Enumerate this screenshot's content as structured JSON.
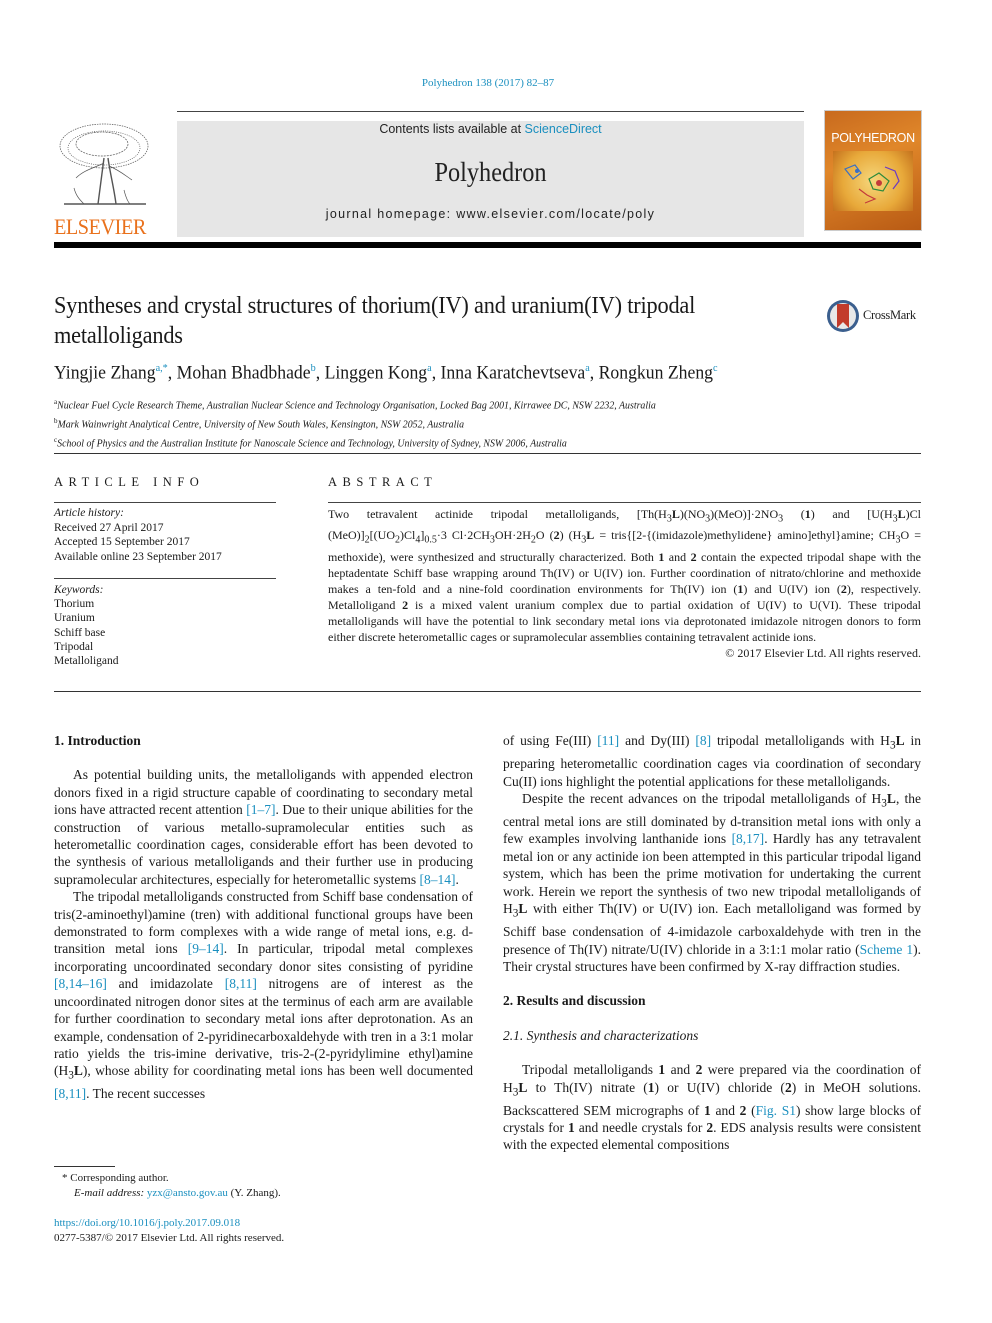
{
  "journal_ref": "Polyhedron 138 (2017) 82–87",
  "masthead": {
    "contents_prefix": "Contents lists available at ",
    "contents_link": "ScienceDirect",
    "journal_name": "Polyhedron",
    "homepage": "journal homepage: www.elsevier.com/locate/poly",
    "publisher_logo": "ELSEVIER",
    "cover_title": "POLYHEDRON"
  },
  "colors": {
    "link": "#1a8fbf",
    "elsevier_orange": "#e9711c",
    "masthead_bg": "#e6e6e6"
  },
  "title": "Syntheses and crystal structures of thorium(IV) and uranium(IV) tripodal metalloligands",
  "crossmark": "CrossMark",
  "authors": [
    {
      "name": "Yingjie Zhang",
      "sup": "a,*"
    },
    {
      "name": "Mohan Bhadbhade",
      "sup": "b"
    },
    {
      "name": "Linggen Kong",
      "sup": "a"
    },
    {
      "name": "Inna Karatchevtseva",
      "sup": "a"
    },
    {
      "name": "Rongkun Zheng",
      "sup": "c"
    }
  ],
  "affiliations": [
    {
      "key": "a",
      "text": "Nuclear Fuel Cycle Research Theme, Australian Nuclear Science and Technology Organisation, Locked Bag 2001, Kirrawee DC, NSW 2232, Australia"
    },
    {
      "key": "b",
      "text": "Mark Wainwright Analytical Centre, University of New South Wales, Kensington, NSW 2052, Australia"
    },
    {
      "key": "c",
      "text": "School of Physics and the Australian Institute for Nanoscale Science and Technology, University of Sydney, NSW 2006, Australia"
    }
  ],
  "article_info": {
    "heading": "ARTICLE INFO",
    "history_label": "Article history:",
    "received": "Received 27 April 2017",
    "accepted": "Accepted 15 September 2017",
    "online": "Available online 23 September 2017",
    "keywords_label": "Keywords:",
    "keywords": [
      "Thorium",
      "Uranium",
      "Schiff base",
      "Tripodal",
      "Metalloligand"
    ]
  },
  "abstract": {
    "heading": "ABSTRACT",
    "copyright": "© 2017 Elsevier Ltd. All rights reserved."
  },
  "intro": {
    "heading": "1. Introduction",
    "refs": [
      "[1–7]",
      "[8–14]",
      "[9–14]",
      "[8,14–16]",
      "[8,11]",
      "[8,11]"
    ]
  },
  "right_col": {
    "refs": [
      "[11]",
      "[8]",
      "[8,17]",
      "Scheme 1",
      "Fig. S1"
    ],
    "section2_heading": "2. Results and discussion",
    "subsection_heading": "2.1. Synthesis and characterizations"
  },
  "footnotes": {
    "corresponding": "Corresponding author.",
    "email_label": "E-mail address:",
    "email": "yzx@ansto.gov.au",
    "email_suffix": " (Y. Zhang).",
    "doi": "https://doi.org/10.1016/j.poly.2017.09.018",
    "issn": "0277-5387/© 2017 Elsevier Ltd. All rights reserved."
  }
}
